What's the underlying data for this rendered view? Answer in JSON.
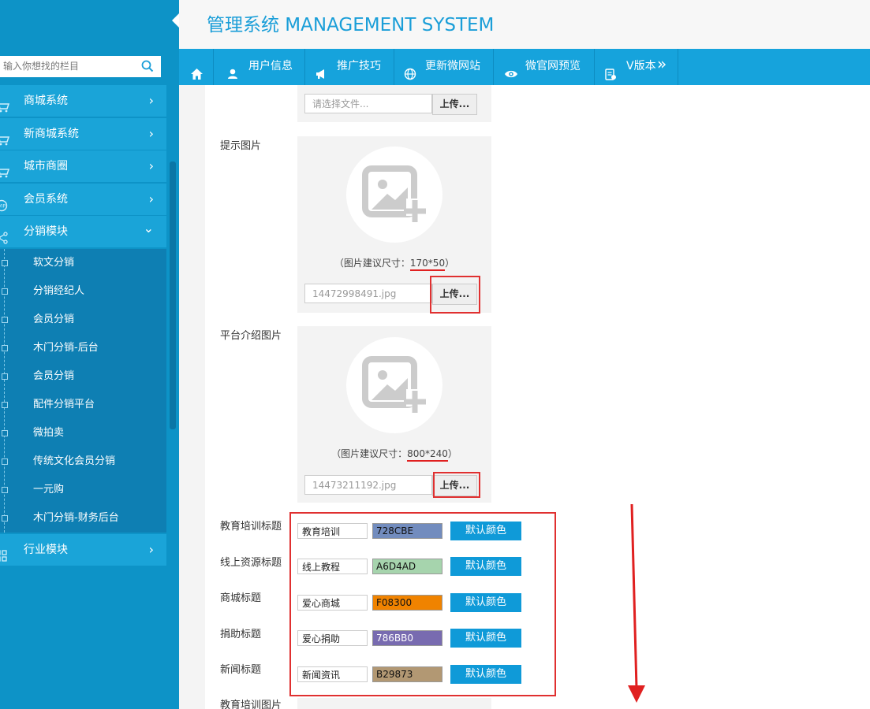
{
  "header": {
    "title": "管理系统 MANAGEMENT SYSTEM"
  },
  "search": {
    "placeholder": "输入你想找的栏目"
  },
  "sidebar": {
    "items": [
      {
        "label": "商城系统",
        "arrow": "›"
      },
      {
        "label": "新商城系统",
        "arrow": "›"
      },
      {
        "label": "城市商圈",
        "arrow": "›"
      },
      {
        "label": "会员系统",
        "arrow": "›"
      },
      {
        "label": "分销模块",
        "arrow": "⌄"
      }
    ],
    "sub_items": [
      "软文分销",
      "分销经纪人",
      "会员分销",
      "木门分销-后台",
      "会员分销",
      "配件分销平台",
      "微拍卖",
      "传统文化会员分销",
      "一元购",
      "木门分销-财务后台"
    ],
    "after": {
      "label": "行业模块",
      "arrow": "›"
    }
  },
  "nav": {
    "items": [
      {
        "label": "用户信息",
        "icon": "user-icon"
      },
      {
        "label": "推广技巧",
        "icon": "megaphone-icon"
      },
      {
        "label": "更新微网站",
        "icon": "globe-icon"
      },
      {
        "label": "微官网预览",
        "icon": "eye-icon"
      },
      {
        "label": "V版本",
        "icon": "clipboard-icon"
      }
    ],
    "more": "»"
  },
  "form": {
    "file_top": {
      "placeholder": "请选择文件...",
      "button": "上传..."
    },
    "tip_image": {
      "label": "提示图片",
      "hint_prefix": "（图片建议尺寸：",
      "size": "170*50",
      "hint_suffix": "）",
      "filename": "14472998491.jpg",
      "button": "上传..."
    },
    "platform_image": {
      "label": "平台介绍图片",
      "hint_prefix": "（图片建议尺寸：",
      "size": "800*240",
      "hint_suffix": "）",
      "filename": "14473211192.jpg",
      "button": "上传..."
    },
    "titles": [
      {
        "label": "教育培训标题",
        "text": "教育培训",
        "color": "728CBE",
        "button": "默认颜色"
      },
      {
        "label": "线上资源标题",
        "text": "线上教程",
        "color": "A6D4AD",
        "button": "默认颜色"
      },
      {
        "label": "商城标题",
        "text": "爱心商城",
        "color": "F08300",
        "button": "默认颜色"
      },
      {
        "label": "捐助标题",
        "text": "爱心捐助",
        "color": "786BB0",
        "button": "默认颜色"
      },
      {
        "label": "新闻标题",
        "text": "新闻资讯",
        "color": "B29873",
        "button": "默认颜色"
      }
    ],
    "edu_image": {
      "label": "教育培训图片"
    }
  },
  "colors": {
    "sidebar": "#0d93c7",
    "accent": "#16a3dc",
    "annotation": "#e03030"
  }
}
